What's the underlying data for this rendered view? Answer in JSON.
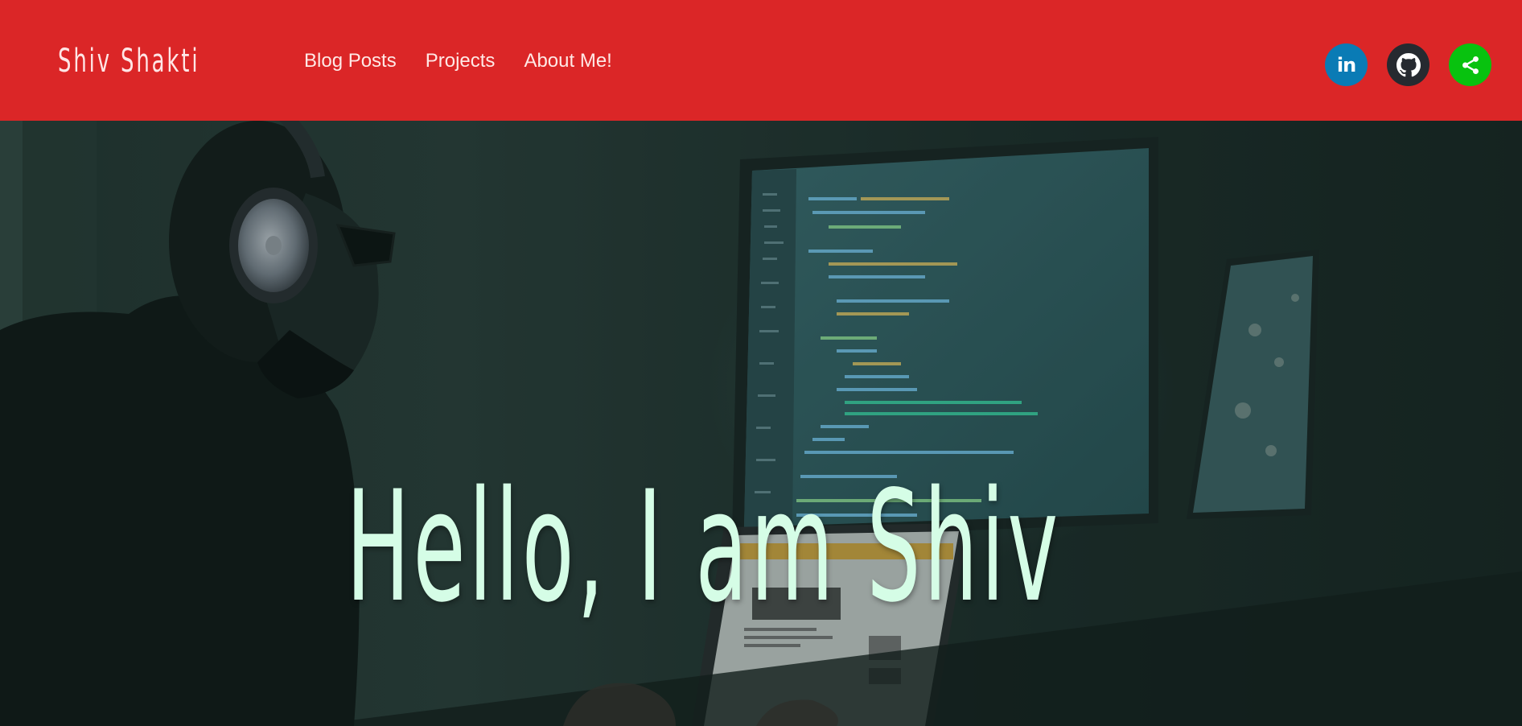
{
  "header": {
    "brand": "Shiv Shakti",
    "nav": [
      {
        "label": "Blog Posts"
      },
      {
        "label": "Projects"
      },
      {
        "label": "About Me!"
      }
    ],
    "social": [
      {
        "icon": "linkedin-icon",
        "label": "in",
        "color": "#0a7bb5"
      },
      {
        "icon": "github-icon",
        "color": "#262a30"
      },
      {
        "icon": "share-icon",
        "color": "#08c20f"
      }
    ],
    "background_color": "#db2627"
  },
  "hero": {
    "title": "Hello, I am Shiv",
    "title_color": "#d5fde6"
  }
}
